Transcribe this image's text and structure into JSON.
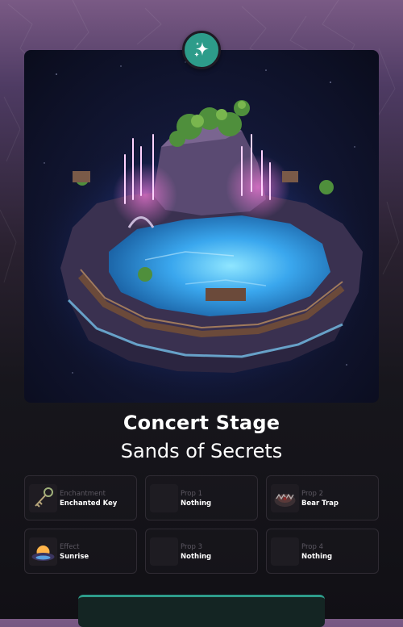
{
  "card": {
    "title": "Concert Stage",
    "subtitle": "Sands of Secrets",
    "badge_icon": "sparkles-icon",
    "accent_color": "#2d9c8a",
    "image_description": "isometric floating island with lagoon"
  },
  "slots": [
    {
      "label": "Enchantment",
      "value": "Enchanted Key",
      "icon": "key-icon"
    },
    {
      "label": "Prop 1",
      "value": "Nothing",
      "icon": "empty-slot-icon"
    },
    {
      "label": "Prop 2",
      "value": "Bear Trap",
      "icon": "bear-trap-icon"
    },
    {
      "label": "Effect",
      "value": "Sunrise",
      "icon": "sunrise-icon"
    },
    {
      "label": "Prop 3",
      "value": "Nothing",
      "icon": "empty-slot-icon"
    },
    {
      "label": "Prop 4",
      "value": "Nothing",
      "icon": "empty-slot-icon"
    }
  ]
}
